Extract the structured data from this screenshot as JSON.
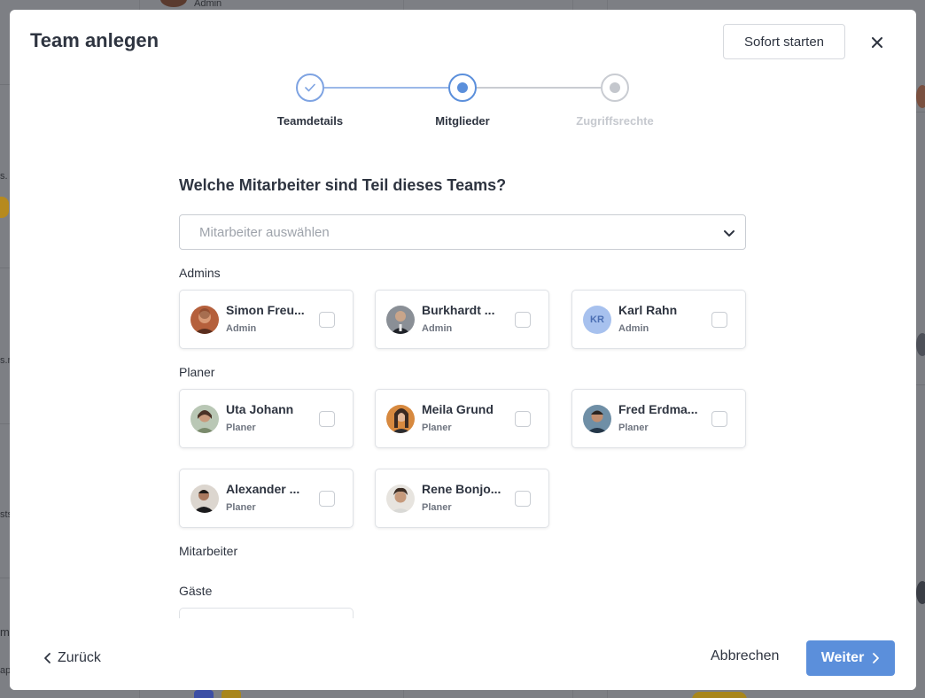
{
  "modal": {
    "title": "Team anlegen",
    "start_now_label": "Sofort starten"
  },
  "stepper": {
    "steps": [
      {
        "label": "Teamdetails",
        "state": "done"
      },
      {
        "label": "Mitglieder",
        "state": "active"
      },
      {
        "label": "Zugriffsrechte",
        "state": "pending"
      }
    ]
  },
  "form": {
    "question": "Welche Mitarbeiter sind Teil dieses Teams?",
    "select_placeholder": "Mitarbeiter auswählen"
  },
  "groups": {
    "admins": {
      "label": "Admins",
      "members": [
        {
          "name": "Simon Freu...",
          "role": "Admin",
          "avatar": "photo"
        },
        {
          "name": "Burkhardt ...",
          "role": "Admin",
          "avatar": "photo"
        },
        {
          "name": "Karl Rahn",
          "role": "Admin",
          "avatar": "initials",
          "initials": "KR"
        }
      ]
    },
    "planer": {
      "label": "Planer",
      "members": [
        {
          "name": "Uta Johann",
          "role": "Planer",
          "avatar": "photo"
        },
        {
          "name": "Meila Grund",
          "role": "Planer",
          "avatar": "photo"
        },
        {
          "name": "Fred Erdma...",
          "role": "Planer",
          "avatar": "photo"
        },
        {
          "name": "Alexander ...",
          "role": "Planer",
          "avatar": "photo"
        },
        {
          "name": "Rene Bonjo...",
          "role": "Planer",
          "avatar": "photo"
        }
      ]
    },
    "mitarbeiter": {
      "label": "Mitarbeiter"
    },
    "gaeste": {
      "label": "Gäste"
    }
  },
  "footer": {
    "back_label": "Zurück",
    "cancel_label": "Abbrechen",
    "next_label": "Weiter"
  },
  "colors": {
    "accent": "#5b8fdb",
    "step_done_line": "#9bb8e8",
    "step_pending": "#c9ccd2",
    "step_pending_text": "#c6c9cf",
    "text": "#2e3440"
  },
  "background_app": {
    "left_edge_fragments": [
      "s.",
      "s.n",
      "sts",
      "m",
      "ap"
    ]
  }
}
